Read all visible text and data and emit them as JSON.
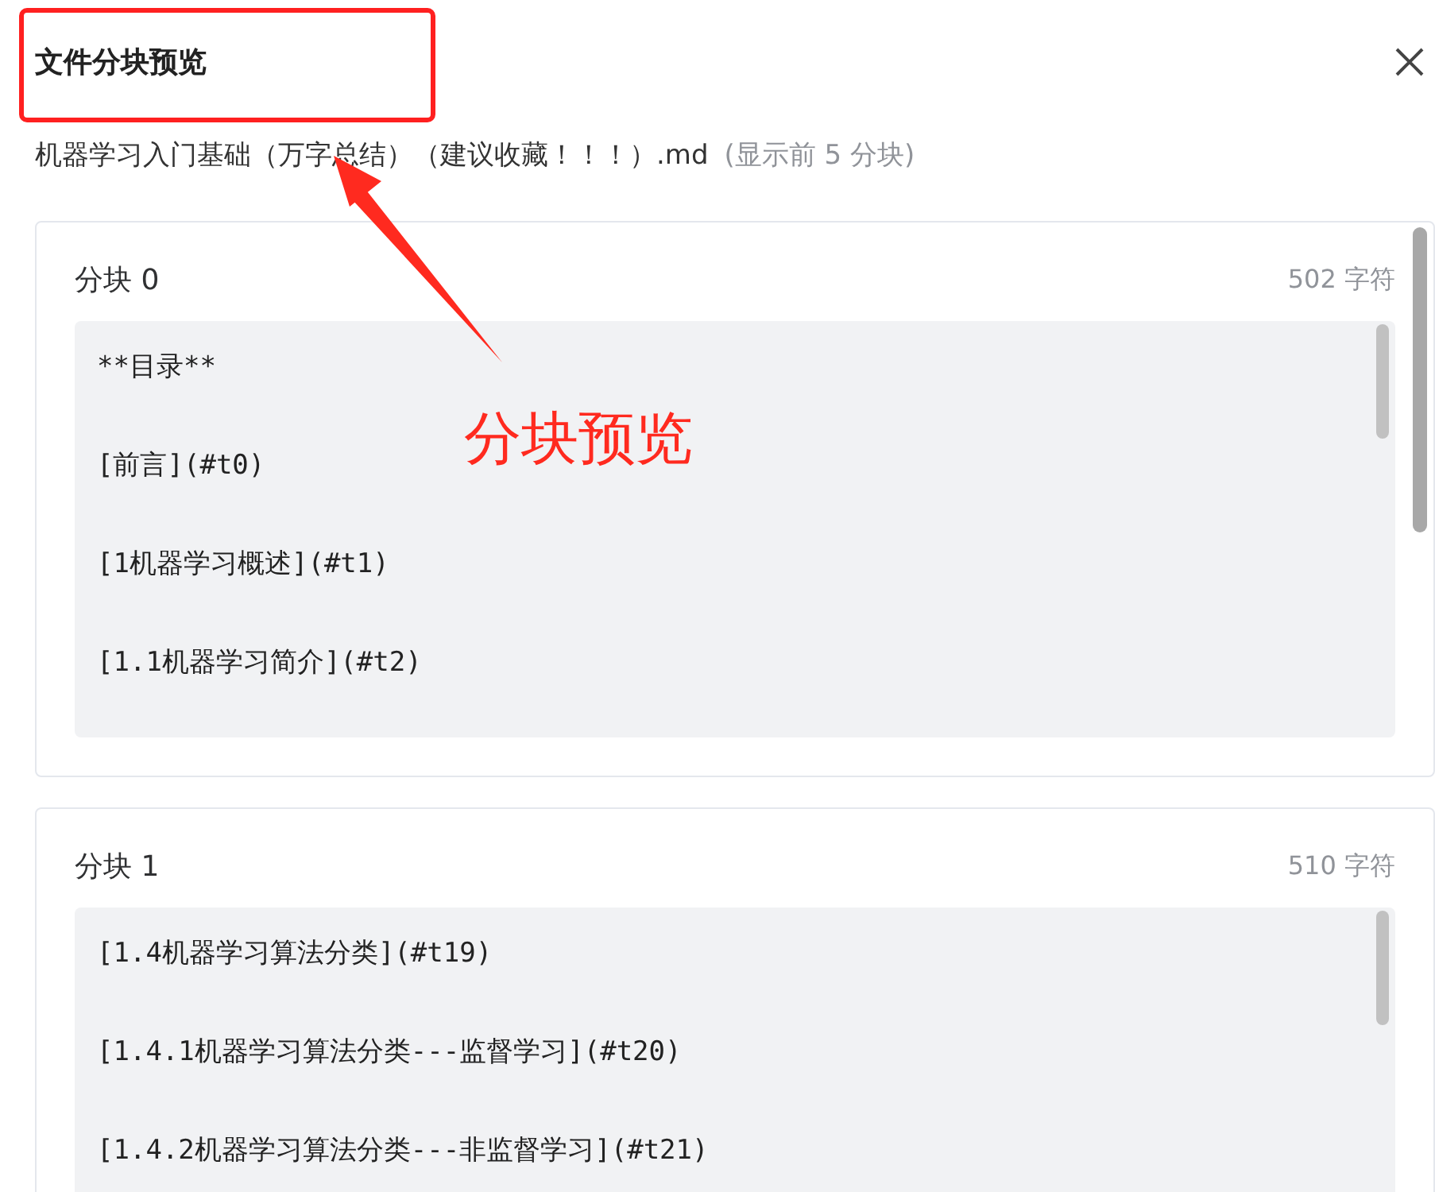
{
  "dialog": {
    "title": "文件分块预览",
    "file_name": "机器学习入门基础（万字总结）（建议收藏！！！）.md",
    "note": "(显示前 5 分块)"
  },
  "chunks": [
    {
      "title": "分块 0",
      "count": "502 字符",
      "lines": [
        "**目录**",
        "[前言](#t0)",
        "[1机器学习概述](#t1)",
        "[1.1机器学习简介](#t2)"
      ]
    },
    {
      "title": "分块 1",
      "count": "510 字符",
      "lines": [
        "[1.4机器学习算法分类](#t19)",
        "[1.4.1机器学习算法分类---监督学习](#t20)",
        "[1.4.2机器学习算法分类---非监督学习](#t21)"
      ]
    }
  ],
  "annotation": {
    "label": "分块预览"
  }
}
